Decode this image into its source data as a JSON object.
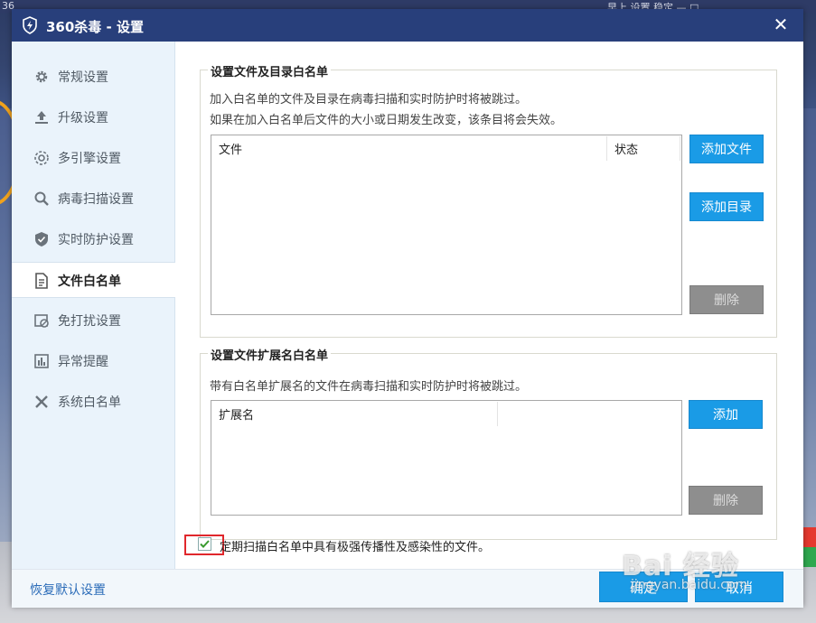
{
  "desktop": {
    "top_left_text": "36",
    "top_right_text": "早上  设置  稳定 —  □"
  },
  "window": {
    "title": "360杀毒 - 设置",
    "close_glyph": "✕",
    "accent_color": "#283f7b"
  },
  "sidebar": {
    "items": [
      {
        "label": "常规设置",
        "icon": "gear-icon"
      },
      {
        "label": "升级设置",
        "icon": "upload-icon"
      },
      {
        "label": "多引擎设置",
        "icon": "engine-icon"
      },
      {
        "label": "病毒扫描设置",
        "icon": "search-icon"
      },
      {
        "label": "实时防护设置",
        "icon": "shield-icon"
      },
      {
        "label": "文件白名单",
        "icon": "document-icon",
        "active": true
      },
      {
        "label": "免打扰设置",
        "icon": "do-not-disturb-icon"
      },
      {
        "label": "异常提醒",
        "icon": "bar-chart-icon"
      },
      {
        "label": "系统白名单",
        "icon": "tools-icon"
      }
    ]
  },
  "file_whitelist": {
    "legend": "设置文件及目录白名单",
    "desc_line1": "加入白名单的文件及目录在病毒扫描和实时防护时将被跳过。",
    "desc_line2": "如果在加入白名单后文件的大小或日期发生改变，该条目将会失效。",
    "col_file": "文件",
    "col_status": "状态",
    "add_file_label": "添加文件",
    "add_dir_label": "添加目录",
    "delete_label": "删除"
  },
  "ext_whitelist": {
    "legend": "设置文件扩展名白名单",
    "desc": "带有白名单扩展名的文件在病毒扫描和实时防护时将被跳过。",
    "col_ext": "扩展名",
    "add_label": "添加",
    "delete_label": "删除"
  },
  "periodic_scan": {
    "label": "定期扫描白名单中具有极强传播性及感染性的文件。",
    "checked": true
  },
  "footer": {
    "restore_label": "恢复默认设置",
    "ok_label": "确定",
    "cancel_label": "取消"
  },
  "watermark": {
    "main": "Bai 经验",
    "sub": "jingyan.baidu.com"
  }
}
